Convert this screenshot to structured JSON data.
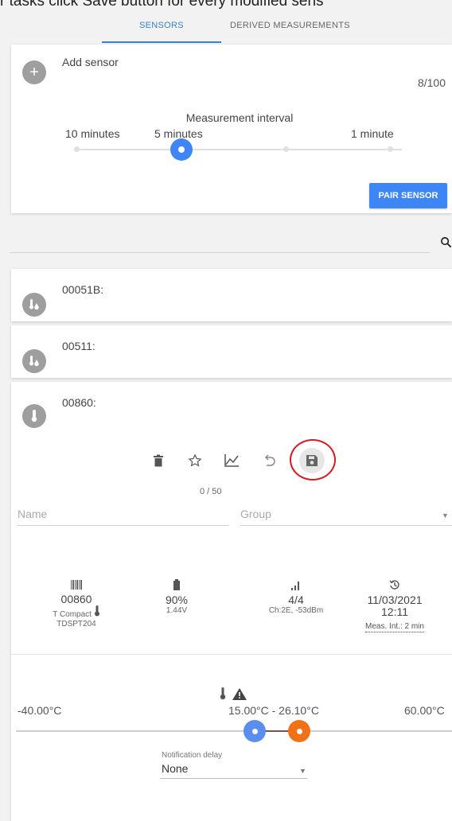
{
  "top_caption": "r tasks click Save       button for every modified sens",
  "tabs": {
    "sensors": "SENSORS",
    "derived": "DERIVED MEASUREMENTS"
  },
  "add_card": {
    "add_label": "Add sensor",
    "count": "8/100",
    "interval_title": "Measurement interval",
    "ticks": [
      "10 minutes",
      "5 minutes",
      "1 minute"
    ],
    "interval_selected": "5 minutes",
    "pair_button": "PAIR SENSOR"
  },
  "search": {
    "icon": "search-icon"
  },
  "sensors": [
    {
      "id": "00051B:",
      "icon": "temp-humidity-icon"
    },
    {
      "id": "00511:",
      "icon": "temp-humidity-icon"
    }
  ],
  "detail": {
    "id": "00860:",
    "icon": "thermometer-icon",
    "actions": [
      "delete-icon",
      "star-icon",
      "chart-icon",
      "undo-icon",
      "save-icon"
    ],
    "name_label": "Name",
    "group_label": "Group",
    "char_count": "0 / 50",
    "info": {
      "serial": "00860",
      "model": "T Compact",
      "code": "TDSPT204",
      "battery_pct": "90%",
      "battery_v": "1.44V",
      "signal": "4/4",
      "signal_detail": "Ch:2E, -53dBm",
      "date": "11/03/2021",
      "time": "12:11",
      "meas_int": "Meas. Int.: 2 min"
    },
    "range": {
      "min": "-40.00°C",
      "max": "60.00°C",
      "selected": "15.00°C - 26.10°C",
      "low_value": 15.0,
      "high_value": 26.1,
      "low_color": "#5b8def",
      "high_color": "#f07116"
    },
    "notification": {
      "label": "Notification delay",
      "value": "None"
    }
  },
  "colors": {
    "accent": "#3e86f5",
    "highlight_ring": "#d71920"
  }
}
